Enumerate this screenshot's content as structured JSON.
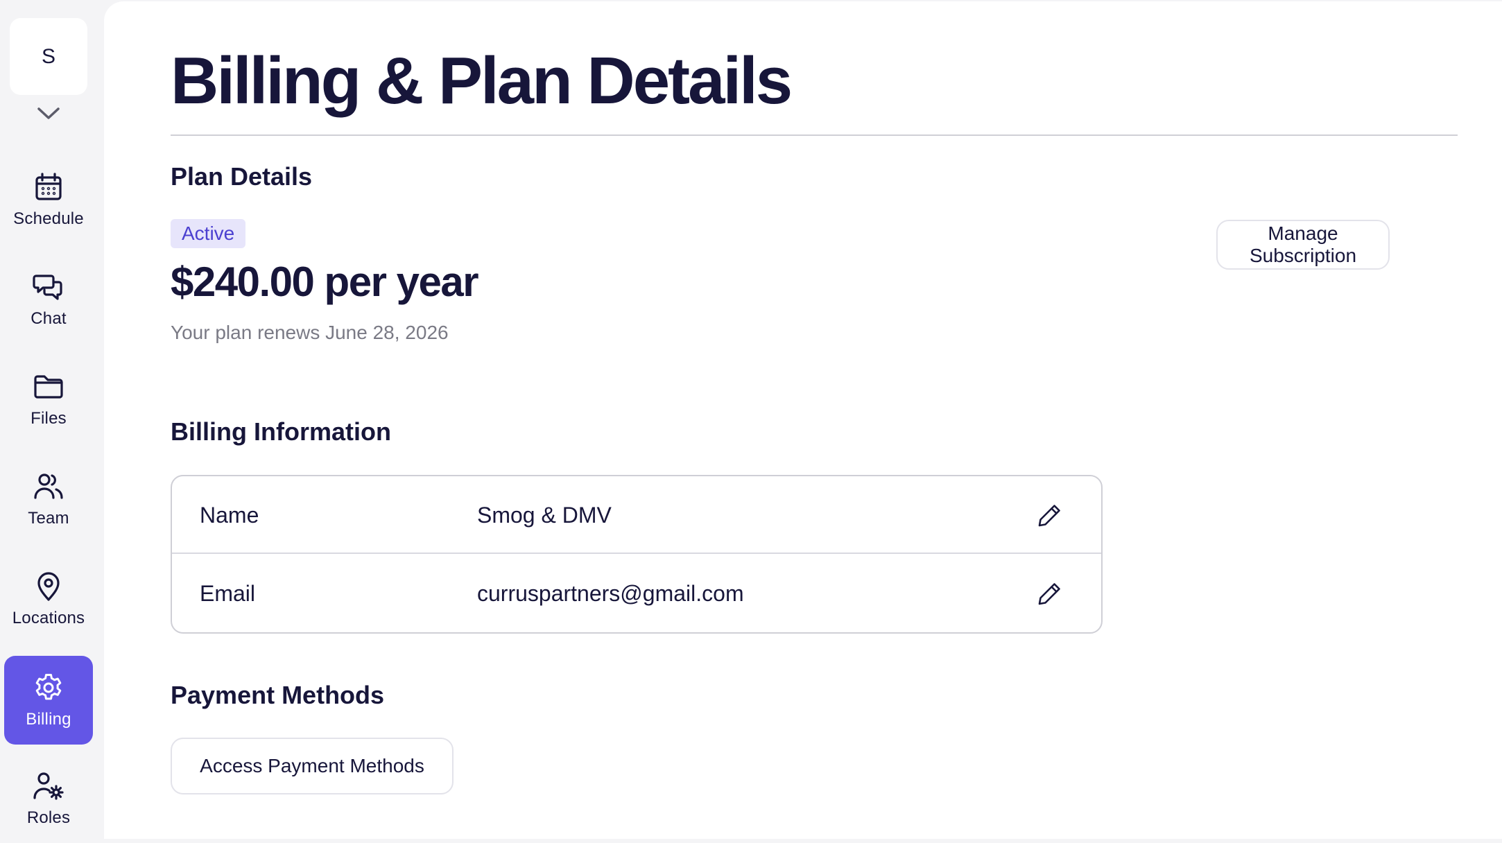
{
  "sidebar": {
    "org_initial": "S",
    "items": [
      {
        "label": "Schedule",
        "icon": "calendar-icon"
      },
      {
        "label": "Chat",
        "icon": "chat-icon"
      },
      {
        "label": "Files",
        "icon": "folder-icon"
      },
      {
        "label": "Team",
        "icon": "users-icon"
      },
      {
        "label": "Locations",
        "icon": "map-pin-icon"
      },
      {
        "label": "Billing",
        "icon": "gear-icon",
        "active": true
      },
      {
        "label": "Roles",
        "icon": "user-cog-icon"
      }
    ]
  },
  "page": {
    "title": "Billing & Plan Details"
  },
  "plan": {
    "heading": "Plan Details",
    "status": "Active",
    "price": "$240.00 per year",
    "renewal": "Your plan renews June 28, 2026",
    "manage_label": "Manage Subscription"
  },
  "billing_info": {
    "heading": "Billing Information",
    "rows": [
      {
        "label": "Name",
        "value": "Smog & DMV"
      },
      {
        "label": "Email",
        "value": "curruspartners@gmail.com"
      }
    ]
  },
  "payment": {
    "heading": "Payment Methods",
    "button_label": "Access Payment Methods"
  },
  "colors": {
    "accent": "#6356e6",
    "text": "#17163a",
    "muted": "#7a7a85",
    "badge_bg": "#e7e5fb",
    "badge_text": "#4b40d0"
  }
}
